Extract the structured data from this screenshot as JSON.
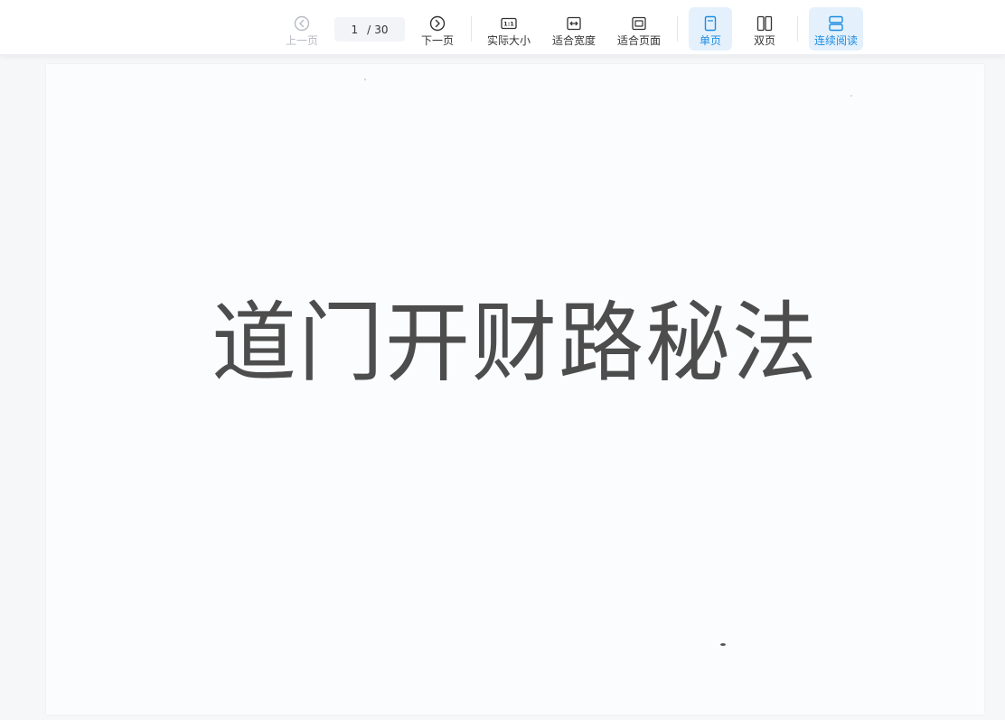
{
  "toolbar": {
    "prev": "上一页",
    "next": "下一页",
    "actual_size": "实际大小",
    "actual_size_icon_text": "1:1",
    "fit_width": "适合宽度",
    "fit_page": "适合页面",
    "single_page": "单页",
    "double_page": "双页",
    "continuous": "连续阅读"
  },
  "pager": {
    "current": "1",
    "separator": "/",
    "total": "30"
  },
  "document": {
    "title": "道门开财路秘法"
  },
  "colors": {
    "accent": "#1d8ce0",
    "active_bg": "#e4f1fd",
    "disabled": "#b7bbc2"
  },
  "icons": [
    "chevron-left-circle-icon",
    "chevron-right-circle-icon",
    "actual-size-icon",
    "fit-width-icon",
    "fit-page-icon",
    "single-page-icon",
    "double-page-icon",
    "continuous-icon"
  ]
}
